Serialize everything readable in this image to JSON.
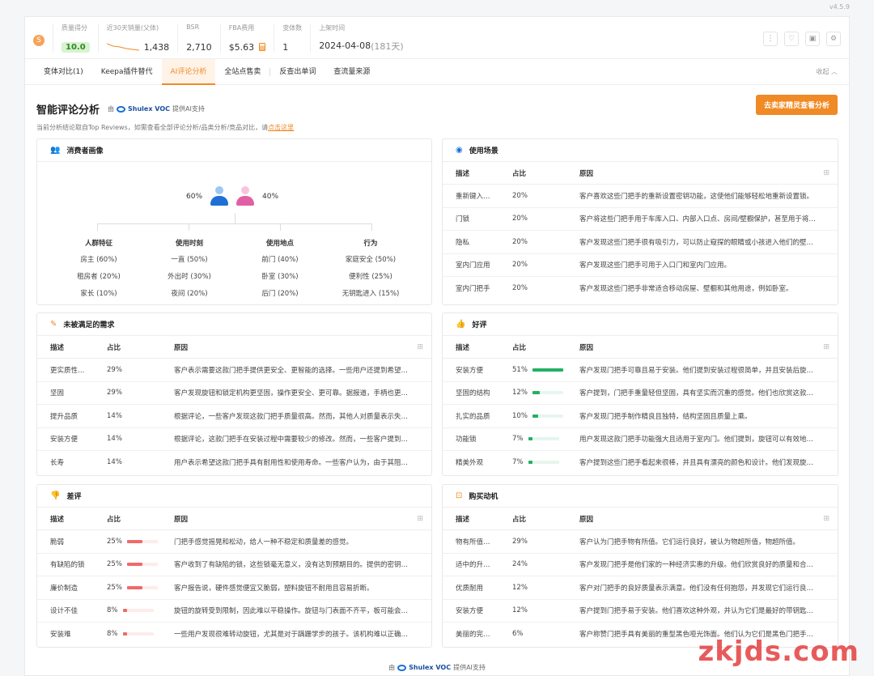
{
  "version": "v4.5.9",
  "stats": {
    "quality": {
      "label": "质量得分",
      "value": "10.0"
    },
    "sales": {
      "label": "近30天销量(父体)",
      "value": "1,438"
    },
    "bsr": {
      "label": "BSR",
      "value": "2,710"
    },
    "fba": {
      "label": "FBA费用",
      "value": "$5.63"
    },
    "variants": {
      "label": "变体数",
      "value": "1"
    },
    "listed": {
      "label": "上架时间",
      "value": "2024-04-08",
      "days": "(181天)"
    }
  },
  "top_icons": [
    "more-icon",
    "heart-icon",
    "video-icon",
    "settings-icon"
  ],
  "tabs": [
    "变体对比(1)",
    "Keepa插件替代",
    "AI评论分析",
    "全站点售卖",
    "反查出单词",
    "查流量来源"
  ],
  "active_tab": 2,
  "collapse_label": "收起",
  "ai": {
    "title": "智能评论分析",
    "by_prefix": "由",
    "brand": "Shulex VOC",
    "by_suffix": "提供AI支持",
    "subtitle": "当前分析结论取自Top Reviews，如需查看全部评论分析/品类分析/竞品对比，请",
    "link": "点击这里",
    "cta": "去卖家精灵查看分析"
  },
  "columns": {
    "desc": "描述",
    "pct": "占比",
    "reason": "原因"
  },
  "consumer": {
    "title": "消费者画像",
    "male_pct": "60%",
    "female_pct": "40%",
    "groups": [
      {
        "title": "人群特征",
        "items": [
          "房主  (60%)",
          "租房者  (20%)",
          "家长  (10%)"
        ]
      },
      {
        "title": "使用时刻",
        "items": [
          "一直  (50%)",
          "外出时  (30%)",
          "夜间  (20%)"
        ]
      },
      {
        "title": "使用地点",
        "items": [
          "前门  (40%)",
          "卧室  (30%)",
          "后门  (20%)"
        ]
      },
      {
        "title": "行为",
        "items": [
          "家庭安全  (50%)",
          "便利性  (25%)",
          "无钥匙进入  (15%)"
        ]
      }
    ]
  },
  "scenarios": {
    "title": "使用场景",
    "rows": [
      {
        "desc": "重新键入…",
        "pct": "20%",
        "reason": "客户喜欢这些门把手的重新设置密钥功能，这使他们能够轻松地重新设置锁。"
      },
      {
        "desc": "门锁",
        "pct": "20%",
        "reason": "客户将这些门把手用于车库入口、内部入口点、房间/壁橱保护，甚至用于将…"
      },
      {
        "desc": "隐私",
        "pct": "20%",
        "reason": "客户发现这些门把手很有吸引力，可以防止窥探的眼睛或小孩进入他们的壁…"
      },
      {
        "desc": "室内门应用",
        "pct": "20%",
        "reason": "客户发现这些门把手可用于入口门和室内门应用。"
      },
      {
        "desc": "室内门把手",
        "pct": "20%",
        "reason": "客户发现这些门把手非常适合移动房屋、壁橱和其他用途，例如卧室。"
      }
    ]
  },
  "unmet": {
    "title": "未被满足的需求",
    "rows": [
      {
        "desc": "更实质性…",
        "pct": "29%",
        "reason": "客户表示需要这款门把手提供更安全、更智能的选择。一些用户还提到希望…"
      },
      {
        "desc": "坚固",
        "pct": "29%",
        "reason": "客户发现旋钮和锁定机构更坚固，操作更安全、更可靠。据报道，手柄也更…"
      },
      {
        "desc": "提升品质",
        "pct": "14%",
        "reason": "根据评论，一些客户发现这款门把手质量很高。然而，其他人对质量表示失…"
      },
      {
        "desc": "安装方便",
        "pct": "14%",
        "reason": "根据评论，这款门把手在安装过程中需要较少的修改。然而，一些客户提到…"
      },
      {
        "desc": "长寿",
        "pct": "14%",
        "reason": "用户表示希望这款门把手具有耐用性和使用寿命。一些客户认为，由于其阻…"
      }
    ]
  },
  "positive": {
    "title": "好评",
    "rows": [
      {
        "desc": "安装方便",
        "pct": "51%",
        "share": 0.51,
        "reason": "客户发现门把手可靠且易于安装。他们提到安装过程很简单，并且安装后旋…"
      },
      {
        "desc": "坚固的结构",
        "pct": "12%",
        "share": 0.12,
        "reason": "客户提到，门把手重量轻但坚固，具有坚实而沉重的感觉。他们也欣赏这款…"
      },
      {
        "desc": "扎实的品质",
        "pct": "10%",
        "share": 0.1,
        "reason": "客户发现门把手制作精良且独特，结构坚固且质量上乘。"
      },
      {
        "desc": "功能锁",
        "pct": "7%",
        "share": 0.07,
        "reason": "用户发现这款门把手功能强大且适用于室内门。他们提到，旋钮可以有效地…"
      },
      {
        "desc": "精美外观",
        "pct": "7%",
        "share": 0.07,
        "reason": "客户提到这些门把手看起来很棒，并且具有漂亮的颜色和设计。他们发现旋…"
      }
    ]
  },
  "negative": {
    "title": "差评",
    "rows": [
      {
        "desc": "脆弱",
        "pct": "25%",
        "share": 0.25,
        "reason": "门把手感觉摇晃和松动，给人一种不稳定和质量差的感觉。"
      },
      {
        "desc": "有缺陷的锁",
        "pct": "25%",
        "share": 0.25,
        "reason": "客户收到了有缺陷的锁，这些锁毫无意义，没有达到预期目的。提供的密钥…"
      },
      {
        "desc": "廉价制造",
        "pct": "25%",
        "share": 0.25,
        "reason": "客户报告说，硬件感觉便宜又脆弱，塑料旋钮不耐用且容易折断。"
      },
      {
        "desc": "设计不佳",
        "pct": "8%",
        "share": 0.08,
        "reason": "旋钮的旋转受到限制，因此难以平稳操作。旋钮与门表面不齐平，板可能会…"
      },
      {
        "desc": "安装难",
        "pct": "8%",
        "share": 0.08,
        "reason": "一些用户发现很难转动旋钮，尤其是对于蹒跚学步的孩子。该机构难以正确…"
      }
    ]
  },
  "motivation": {
    "title": "购买动机",
    "rows": [
      {
        "desc": "物有所值…",
        "pct": "29%",
        "reason": "客户认为门把手物有所值。它们运行良好，被认为物超所值，物超所值。"
      },
      {
        "desc": "适中的升…",
        "pct": "24%",
        "reason": "客户发现门把手是他们家的一种经济实惠的升级。他们欣赏良好的质量和合…"
      },
      {
        "desc": "优质耐用",
        "pct": "12%",
        "reason": "客户对门把手的良好质量表示满意。他们没有任何抱怨，并发现它们运行良…"
      },
      {
        "desc": "安装方便",
        "pct": "12%",
        "reason": "客户提到门把手易于安装。他们喜欢这种外观，并认为它们是最好的带钥匙…"
      },
      {
        "desc": "美丽的完…",
        "pct": "6%",
        "reason": "客户称赞门把手具有美丽的重型黑色哑光饰面。他们认为它们是黑色门把手…"
      }
    ]
  },
  "footer": {
    "by_prefix": "由",
    "brand": "Shulex VOC",
    "by_suffix": "提供AI支持"
  },
  "watermark": "zkjds.com",
  "colors": {
    "accent": "#f08a24",
    "positive": "#23b063",
    "negative": "#ef6a6a"
  }
}
